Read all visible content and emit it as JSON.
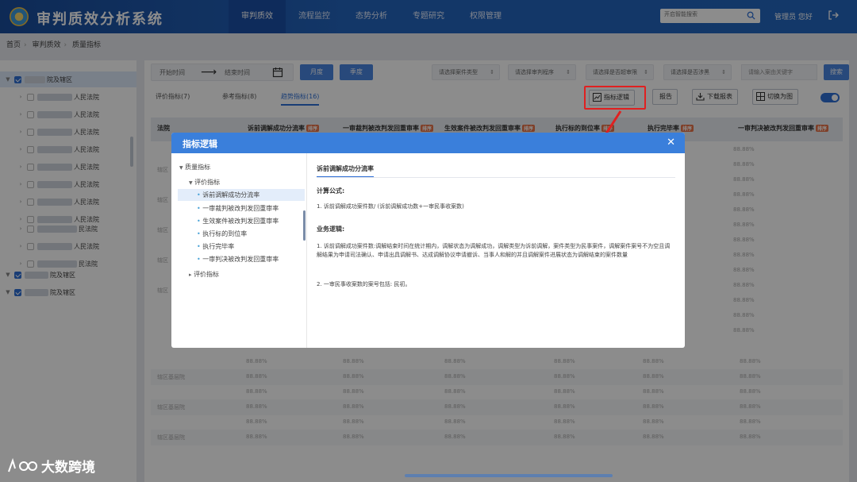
{
  "app": {
    "title": "审判质效分析系统"
  },
  "nav": {
    "items": [
      "审判质效",
      "流程监控",
      "态势分析",
      "专题研究",
      "权限管理"
    ],
    "active_index": 0
  },
  "search": {
    "placeholder": "开启智能搜索"
  },
  "user": {
    "greeting": "管理员 您好"
  },
  "breadcrumb": [
    "首页",
    "审判质效",
    "质量指标"
  ],
  "sidebar": {
    "items": [
      {
        "label": "院及辖区",
        "checked": true,
        "expanded": true
      },
      {
        "label": "人民法院"
      },
      {
        "label": "人民法院"
      },
      {
        "label": "人民法院"
      },
      {
        "label": "人民法院"
      },
      {
        "label": "人民法院"
      },
      {
        "label": "人民法院"
      },
      {
        "label": "人民法院"
      },
      {
        "label": "人民法院"
      },
      {
        "label": "民法院"
      },
      {
        "label": "人民法院"
      },
      {
        "label": "民法院"
      },
      {
        "label": "院及辖区",
        "checked": true,
        "expanded": true
      },
      {
        "label": "院及辖区",
        "checked": true,
        "expanded": true
      }
    ]
  },
  "filters": {
    "start_time": "开始时间",
    "end_time": "结束时间",
    "month_btn": "月度",
    "season_btn": "季度",
    "selects": [
      "请选择案件类型",
      "请选择审判程序",
      "请选择是否超审限",
      "请选择是否涉黑"
    ],
    "keyword_placeholder": "请输入案由关键字",
    "search_btn": "搜索"
  },
  "tabs": [
    {
      "label": "评价指标(7)"
    },
    {
      "label": "参考指标(8)"
    },
    {
      "label": "趋势指标(16)",
      "active": true
    }
  ],
  "toolbar": {
    "logic_btn": "指标逻辑",
    "report_btn": "报告",
    "download_btn": "下载报表",
    "switch_btn": "切换为图"
  },
  "table": {
    "headers": [
      {
        "label": "法院"
      },
      {
        "label": "诉前调解成功分流率",
        "tag": "排序"
      },
      {
        "label": "一审裁判被改判发回重审率",
        "tag": "排序"
      },
      {
        "label": "生效案件被改判发回重审率",
        "tag": "排序"
      },
      {
        "label": "执行标的到位率",
        "tag": "排序"
      },
      {
        "label": "执行完毕率",
        "tag": "排序"
      },
      {
        "label": "一审判决被改判发回重审率",
        "tag": "排序"
      }
    ],
    "rows": [
      {
        "court": "",
        "values": [
          "88.88%",
          "88.88%",
          "88.88%",
          "88.88%",
          "88.88%",
          "88.88%"
        ]
      },
      {
        "court": "辖区基层院",
        "values": [
          "88.88%",
          "88.88%",
          "88.88%",
          "88.88%",
          "88.88%",
          "88.88%"
        ]
      },
      {
        "court": "",
        "values": [
          "88.88%",
          "88.88%",
          "88.88%",
          "88.88%",
          "88.88%",
          "88.88%"
        ]
      },
      {
        "court": "辖区基层院",
        "values": [
          "88.88%",
          "88.88%",
          "88.88%",
          "88.88%",
          "88.88%",
          "88.88%"
        ]
      },
      {
        "court": "",
        "values": [
          "88.88%",
          "88.88%",
          "88.88%",
          "88.88%",
          "88.88%",
          "88.88%"
        ]
      },
      {
        "court": "辖区基层院",
        "values": [
          "88.88%",
          "88.88%",
          "88.88%",
          "88.88%",
          "88.88%",
          "88.88%"
        ]
      }
    ],
    "right_column_values": [
      "88.88%",
      "88.88%",
      "88.88%",
      "88.88%",
      "88.88%",
      "88.88%",
      "88.88%",
      "88.88%",
      "88.88%",
      "88.88%",
      "88.88%",
      "88.88%",
      "88.88%"
    ],
    "partial_court_labels": [
      "辖区",
      "辖区",
      "辖区",
      "辖区",
      "辖区"
    ]
  },
  "modal": {
    "title": "指标逻辑",
    "tree": {
      "root": "质量指标",
      "group1": "评价指标",
      "items": [
        "诉前调解成功分流率",
        "一审裁判被改判发回重审率",
        "生效案件被改判发回重审率",
        "执行标的到位率",
        "执行完毕率",
        "一审判决被改判发回重审率"
      ],
      "group2": "评价指标"
    },
    "body": {
      "title": "诉前调解成功分流率",
      "formula_heading": "计算公式:",
      "formula": "1. 诉前调解成功案件数/ (诉前调解成功数+一审民事收案数)",
      "logic_heading": "业务逻辑:",
      "logic_1": "1. 诉前调解成功案件数:调解结束时间在统计期内，调解状态为调解成功，调解类型为诉前调解，案件类型为民事案件，调解案件案号不为空且调解结果为申请司法确认、申请出具调解书、达成调解协议申请撤诉、当事人和解的并且调解案件进展状态为调解结束的案件数量",
      "logic_2": "2. 一审民事收案数的案号包括: 民初。"
    }
  },
  "watermark": {
    "text": "大数跨境"
  }
}
